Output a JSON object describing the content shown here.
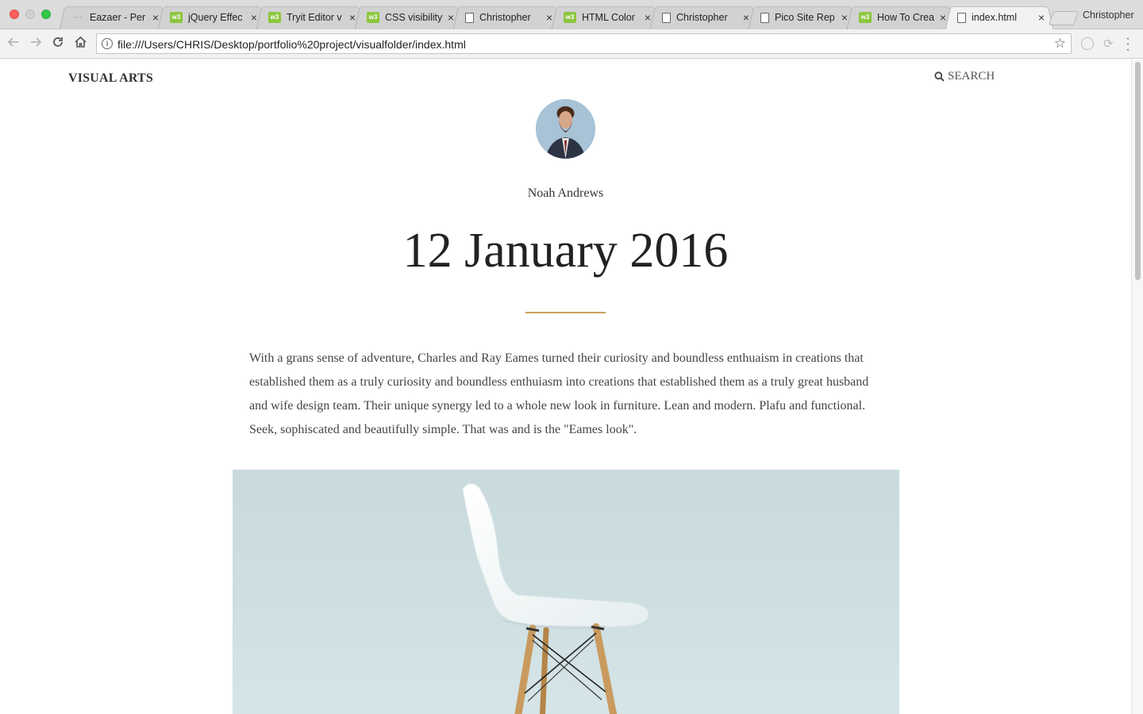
{
  "browser": {
    "tabs": [
      {
        "title": "Eazaer - Per",
        "favicon": "dots-icon",
        "active": false
      },
      {
        "title": "jQuery Effec",
        "favicon": "w3schools-icon",
        "active": false
      },
      {
        "title": "Tryit Editor v",
        "favicon": "w3schools-icon",
        "active": false
      },
      {
        "title": "CSS visibility",
        "favicon": "w3schools-icon",
        "active": false
      },
      {
        "title": "Christopher",
        "favicon": "document-icon",
        "active": false
      },
      {
        "title": "HTML Color",
        "favicon": "w3schools-icon",
        "active": false
      },
      {
        "title": "Christopher",
        "favicon": "document-icon",
        "active": false
      },
      {
        "title": "Pico Site Rep",
        "favicon": "document-icon",
        "active": false
      },
      {
        "title": "How To Crea",
        "favicon": "w3schools-icon",
        "active": false
      },
      {
        "title": "index.html",
        "favicon": "document-icon",
        "active": true
      }
    ],
    "profile_name": "Christopher",
    "url": "file:///Users/CHRIS/Desktop/portfolio%20project/visualfolder/index.html",
    "close_glyph": "×",
    "w3_glyph": "w3"
  },
  "site": {
    "title": "VISUAL ARTS",
    "search_label": "SEARCH"
  },
  "post": {
    "author": "Noah Andrews",
    "date": "12 January 2016",
    "body": "With a grans sense of adventure, Charles and Ray Eames turned their curiosity and boundless enthuaism in creations that established them as a truly curiosity and boundless enthuiasm into creations that established them as a truly great husband and wife design team. Their unique synergy led to a whole new look in furniture. Lean and modern. Plafu and functional. Seek, sophiscated and beautifully simple. That was and is the \"Eames look\"."
  },
  "colors": {
    "accent_divider": "#c9a35b",
    "hero_background": "#cfe0e3"
  }
}
